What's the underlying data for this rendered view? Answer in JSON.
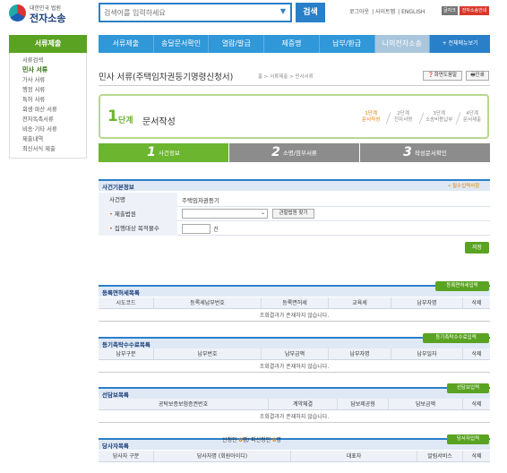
{
  "logo": {
    "sub": "대한민국 법원",
    "main": "전자소송"
  },
  "search": {
    "placeholder": "검색어를 입력하세요",
    "button": "검색"
  },
  "util": {
    "links": [
      "로그아웃",
      "사이트맵",
      "ENGLISH"
    ],
    "btn1": "글자크기",
    "btn2": "전자소송안내"
  },
  "gnb": [
    "서류제출",
    "송달문서확인",
    "열람/발급",
    "제증명",
    "납부/환급",
    "나의전자소송",
    "+ 전체메뉴보기"
  ],
  "sidebar": {
    "title": "서류제출",
    "items": [
      "서류검색",
      "민사 서류",
      "가사 서류",
      "행정 서류",
      "특허 서류",
      "회생·파산 서류",
      "전자독촉서류",
      "비송·기타 서류",
      "제출내역",
      "최신서식 제출"
    ]
  },
  "page": {
    "title": "민사 서류(주택임차권등기명령신청서)",
    "breadcrumb": "홈 > 서류제출 > 민사서류",
    "guide_btn": "화면도움말",
    "print_btn": "인쇄"
  },
  "step": {
    "num": "1",
    "label": "단계",
    "name": "문서작성",
    "steps": [
      {
        "top": "1단계",
        "bottom": "문서작성"
      },
      {
        "top": "2단계",
        "bottom": "전자서명"
      },
      {
        "top": "3단계",
        "bottom": "소송비용납부"
      },
      {
        "top": "4단계",
        "bottom": "문서제출"
      }
    ]
  },
  "tabs": [
    {
      "num": "1",
      "label": "사건정보"
    },
    {
      "num": "2",
      "label": "소명/첨부서류"
    },
    {
      "num": "3",
      "label": "작성문서확인"
    }
  ],
  "case_info": {
    "title": "사건기본정보",
    "note": "• 필수입력사항",
    "rows": {
      "case_type": {
        "label": "사건명",
        "value": "주택임차권등기"
      },
      "court": {
        "label": "제출법원",
        "find": "관할법원 찾기"
      },
      "count": {
        "label": "집행대상 목적물수",
        "unit": "건"
      }
    },
    "save": "저장"
  },
  "registry": {
    "title": "등록면허세목록",
    "button": "등록면허세입력",
    "headers": [
      "시도코드",
      "등록세납부번호",
      "등록면허세",
      "교육세",
      "납부자명",
      "삭제"
    ],
    "empty": "조회결과가 존재하지 않습니다."
  },
  "fee": {
    "title": "등기촉탁수수료목록",
    "button": "등기촉탁수수료입력",
    "headers": [
      "납부구분",
      "납부번호",
      "납부금액",
      "납부자명",
      "납부일자",
      "삭제"
    ],
    "empty": "조회결과가 존재하지 않습니다."
  },
  "bond": {
    "title": "선담보목록",
    "button": "선담보입력",
    "headers": [
      "공탁보증보험증권번호",
      "계약체결",
      "담보제공형",
      "담보금액",
      "삭제"
    ],
    "empty": "조회결과가 존재하지 않습니다."
  },
  "party": {
    "title": "당사자목록",
    "counter": {
      "prefix": "신청인",
      "a": "0",
      "mid": "명/ 피신청인",
      "b": "0",
      "suffix": "명"
    },
    "button": "당사자입력",
    "headers": [
      "당사자 구분",
      "당사자명 (회원아이디)",
      "대표자",
      "알림서비스",
      "삭제"
    ]
  }
}
